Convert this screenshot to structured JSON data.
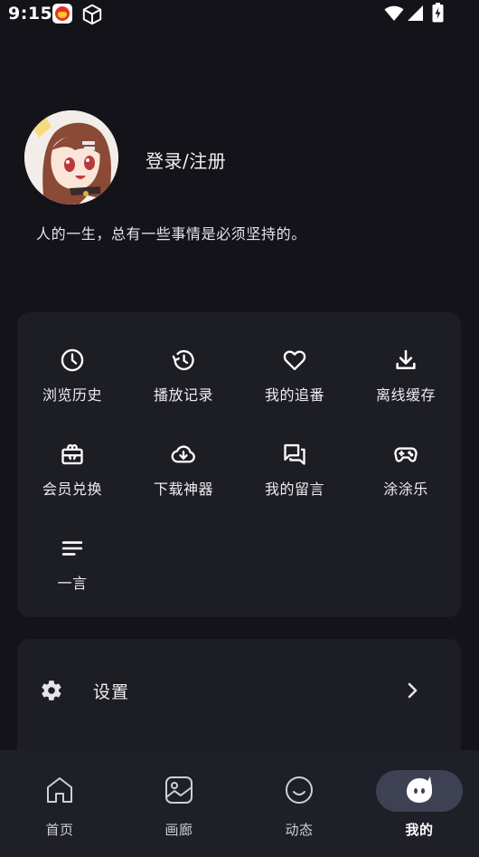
{
  "status_bar": {
    "time": "9:15",
    "icons": [
      "app-notification-icon",
      "cube-icon",
      "wifi-icon",
      "signal-icon",
      "battery-charging-icon"
    ]
  },
  "profile": {
    "login_label": "登录/注册",
    "motto": "人的一生，总有一些事情是必须坚持的。",
    "avatar_alt": "avatar"
  },
  "grid": {
    "items": [
      {
        "label": "浏览历史",
        "icon": "clock-icon"
      },
      {
        "label": "播放记录",
        "icon": "history-icon"
      },
      {
        "label": "我的追番",
        "icon": "heart-icon"
      },
      {
        "label": "离线缓存",
        "icon": "download-icon"
      },
      {
        "label": "会员兑换",
        "icon": "redeem-icon"
      },
      {
        "label": "下载神器",
        "icon": "cloud-download-icon"
      },
      {
        "label": "我的留言",
        "icon": "forum-icon"
      },
      {
        "label": "涂涂乐",
        "icon": "gamepad-icon"
      },
      {
        "label": "一言",
        "icon": "lines-icon"
      }
    ]
  },
  "settings": {
    "label": "设置",
    "icon": "gear-icon"
  },
  "bottom_nav": {
    "items": [
      {
        "label": "首页",
        "icon": "home-icon"
      },
      {
        "label": "画廊",
        "icon": "gallery-icon"
      },
      {
        "label": "动态",
        "icon": "smile-icon"
      },
      {
        "label": "我的",
        "icon": "mascot-icon"
      }
    ],
    "active_index": 3
  },
  "colors": {
    "background": "#131319",
    "card": "#1d1d24",
    "nav_background": "#1f1f27",
    "nav_active_pill": "#3e4154",
    "text": "#ececf1"
  }
}
